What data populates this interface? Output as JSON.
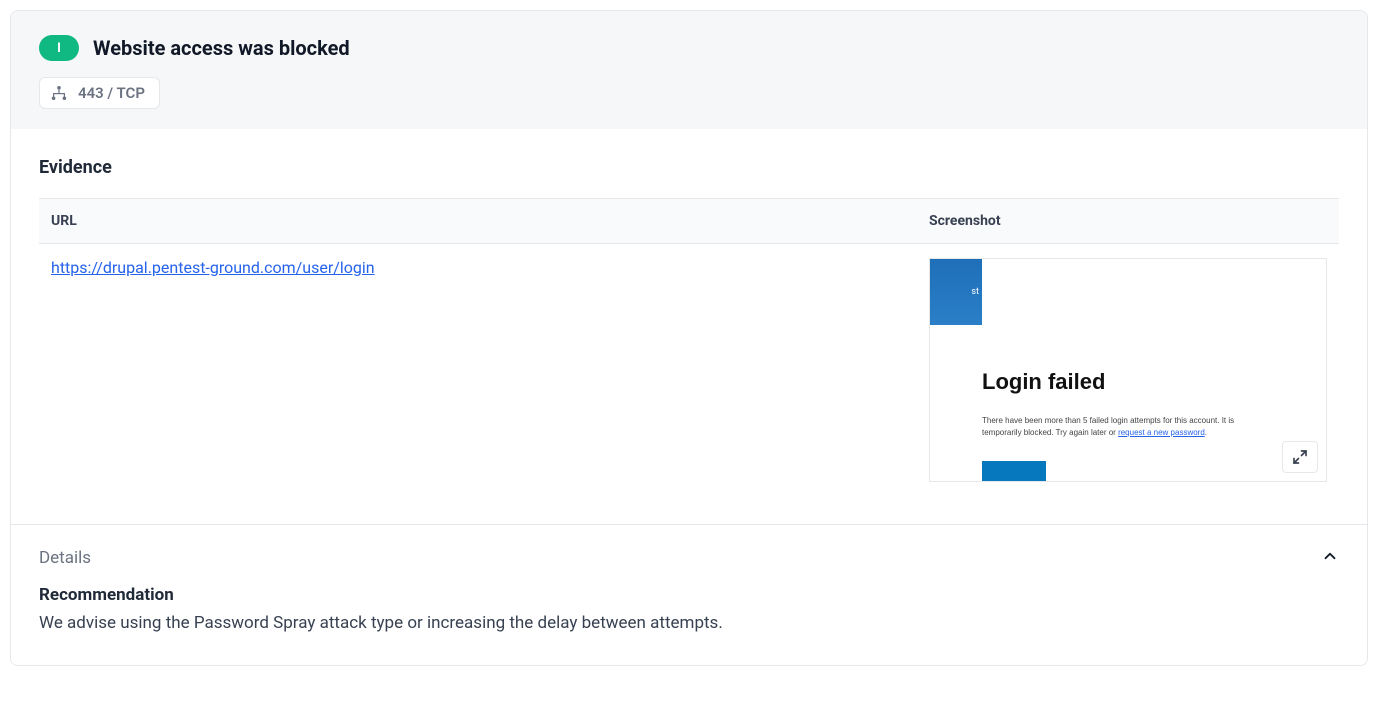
{
  "header": {
    "severity_letter": "I",
    "title": "Website access was blocked",
    "port_protocol": "443 / TCP"
  },
  "evidence": {
    "heading": "Evidence",
    "columns": {
      "url": "URL",
      "screenshot": "Screenshot"
    },
    "row": {
      "url": "https://drupal.pentest-ground.com/user/login",
      "ss_tab_fragment": "st",
      "ss_title": "Login failed",
      "ss_msg_prefix": "There have been more than 5 failed login attempts for this account. It is temporarily blocked. Try again later or ",
      "ss_msg_link": "request a new password",
      "ss_msg_suffix": "."
    }
  },
  "details": {
    "label": "Details",
    "recommendation_heading": "Recommendation",
    "recommendation_text": "We advise using the Password Spray attack type or increasing the delay between attempts."
  }
}
